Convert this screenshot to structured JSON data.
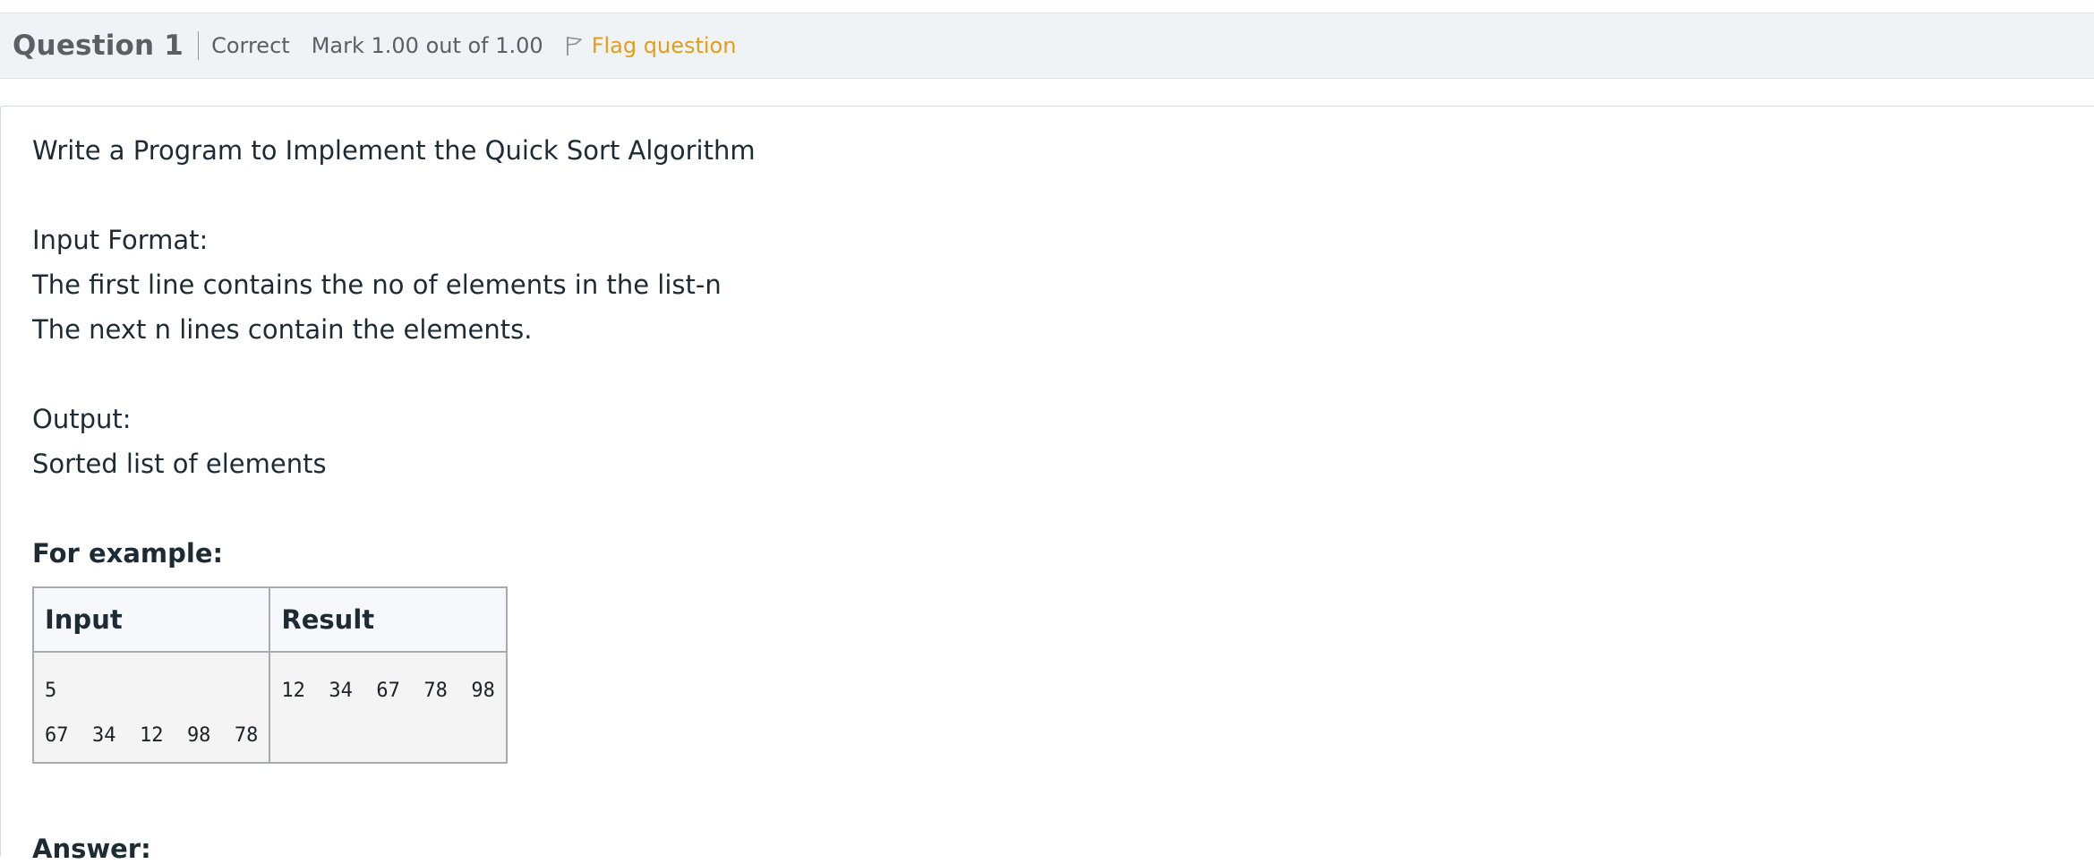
{
  "question_header": {
    "title": "Question 1",
    "state": "Correct",
    "grade": "Mark 1.00 out of 1.00",
    "flag_label": "Flag question",
    "flag_icon": "flag-icon",
    "accent_color": "#e39e16"
  },
  "question_text": {
    "title": "Write a Program to Implement the Quick Sort Algorithm",
    "input_format_label": "Input Format:",
    "input_line_1": "The first line contains the no of elements in the list-n",
    "input_line_2": "The next n lines contain the elements.",
    "output_label": "Output:",
    "output_line_1": "Sorted list of elements",
    "example_label": "For example:"
  },
  "example_table": {
    "headers": [
      "Input",
      "Result"
    ],
    "rows": [
      {
        "input_lines": [
          "5",
          "67  34  12  98  78"
        ],
        "result_lines": [
          "12  34  67  78  98"
        ]
      }
    ]
  },
  "answer_label": "Answer:"
}
